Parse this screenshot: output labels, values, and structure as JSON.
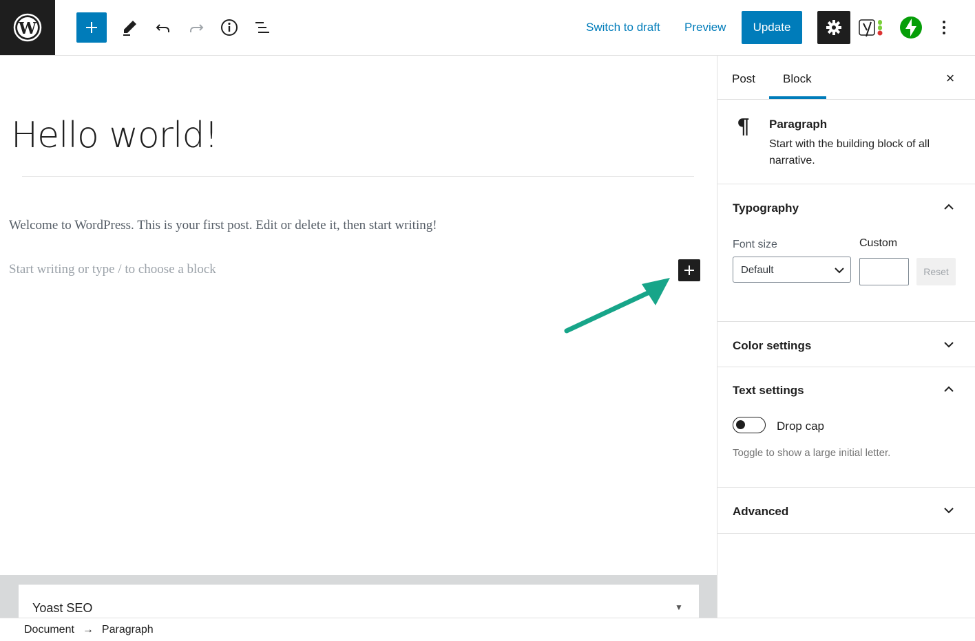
{
  "topbar": {
    "switch_to_draft": "Switch to draft",
    "preview": "Preview",
    "update": "Update"
  },
  "editor": {
    "post_title": "Hello world!",
    "paragraph_text": "Welcome to WordPress. This is your first post. Edit or delete it, then start writing!",
    "block_placeholder": "Start writing or type / to choose a block"
  },
  "sidebar": {
    "tabs": [
      "Post",
      "Block"
    ],
    "active_tab": "Block",
    "close": "×",
    "block_card": {
      "title": "Paragraph",
      "description": "Start with the building block of all narrative."
    },
    "typography": {
      "title": "Typography",
      "font_size_label": "Font size",
      "custom_label": "Custom",
      "select_value": "Default",
      "reset": "Reset"
    },
    "color_settings": {
      "title": "Color settings"
    },
    "text_settings": {
      "title": "Text settings",
      "toggle_label": "Drop cap",
      "toggle_help": "Toggle to show a large initial letter."
    },
    "advanced": {
      "title": "Advanced"
    }
  },
  "metabox": {
    "title": "Yoast SEO"
  },
  "breadcrumb": {
    "document": "Document",
    "arrow": "→",
    "current": "Paragraph"
  },
  "colors": {
    "accent": "#007cba",
    "dark": "#1e1e1e",
    "arrow": "#17a589"
  }
}
